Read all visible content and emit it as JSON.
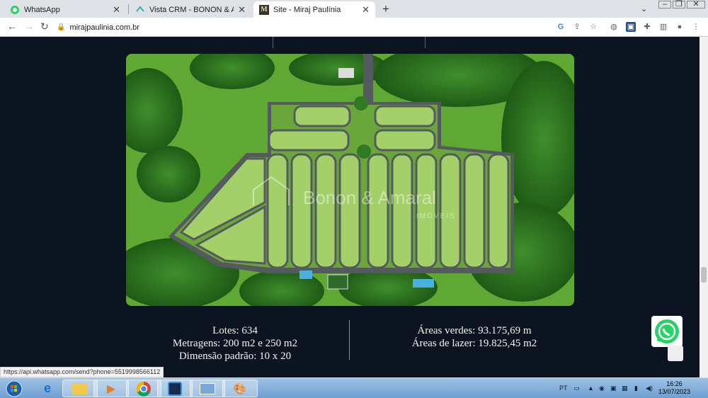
{
  "tabs": [
    {
      "title": "WhatsApp",
      "icon": "whatsapp-icon"
    },
    {
      "title": "Vista CRM - BONON & AMARAL",
      "icon": "vista-crm-icon"
    },
    {
      "title": "Site - Miraj Paulínia",
      "icon": "miraj-m-icon"
    }
  ],
  "address": {
    "url": "mirajpaulinia.com.br"
  },
  "plan": {
    "watermark": "Bonon & Amaral",
    "watermark_sub": "IMÓVEIS"
  },
  "stats_left": {
    "line1": "Lotes: 634",
    "line2": "Metragens: 200 m2 e 250 m2",
    "line3": "Dimensão padrão: 10 x 20"
  },
  "stats_right": {
    "line1": "Áreas verdes: 93.175,69 m",
    "line2": "Áreas de lazer: 19.825,45 m2"
  },
  "status_url": "https://api.whatsapp.com/send?phone=5519998566112",
  "taskbar": {
    "lang": "PT",
    "time": "16:26",
    "date": "13/07/2023"
  },
  "colors": {
    "page_bg": "#0b1420",
    "whatsapp_green": "#25d366",
    "grass": "#4f9a2a",
    "road": "#555a5f"
  }
}
